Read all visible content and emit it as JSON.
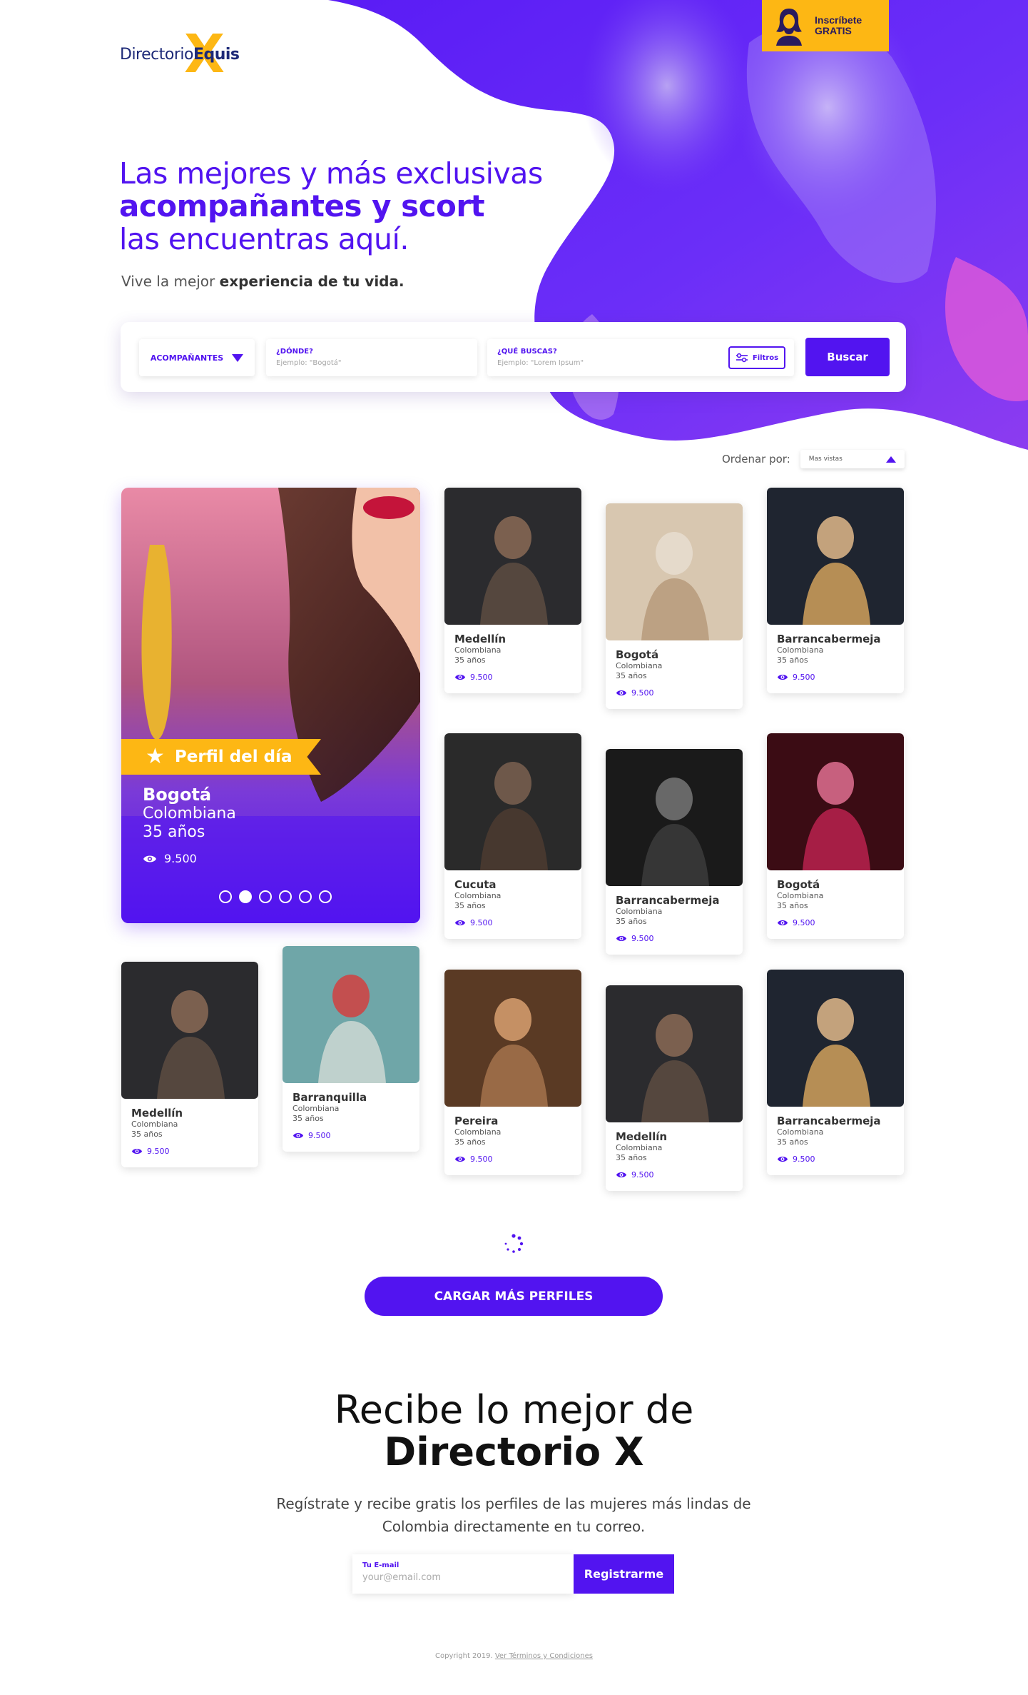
{
  "brand": {
    "name_regular": "Directorio",
    "name_bold": "Equis",
    "mark": "X"
  },
  "header": {
    "signup_line1": "Inscríbete",
    "signup_line2": "GRATIS"
  },
  "hero": {
    "line1": "Las mejores y más exclusivas",
    "line2": "acompañantes y scort",
    "line3": "las encuentras aquí.",
    "tagline_regular": "Vive la mejor ",
    "tagline_bold": "experiencia de tu vida."
  },
  "search": {
    "category": "ACOMPAÑANTES",
    "where_label": "¿DÓNDE?",
    "where_placeholder": "Ejemplo: \"Bogotá\"",
    "what_label": "¿QUÉ BUSCAS?",
    "what_placeholder": "Ejemplo: \"Lorem Ipsum\"",
    "filters_label": "Filtros",
    "submit_label": "Buscar"
  },
  "sort": {
    "label": "Ordenar por:",
    "value": "Mas vistas"
  },
  "featured": {
    "badge": "Perfil del día",
    "city": "Bogotá",
    "nationality": "Colombiana",
    "age": "35 años",
    "views": "9.500",
    "slide_count": 6,
    "active_slide": 2
  },
  "profiles": [
    {
      "city": "Medellín",
      "nationality": "Colombiana",
      "age": "35 años",
      "views": "9.500"
    },
    {
      "city": "Bogotá",
      "nationality": "Colombiana",
      "age": "35 años",
      "views": "9.500"
    },
    {
      "city": "Barrancabermeja",
      "nationality": "Colombiana",
      "age": "35 años",
      "views": "9.500"
    },
    {
      "city": "Cucuta",
      "nationality": "Colombiana",
      "age": "35 años",
      "views": "9.500"
    },
    {
      "city": "Barrancabermeja",
      "nationality": "Colombiana",
      "age": "35 años",
      "views": "9.500"
    },
    {
      "city": "Bogotá",
      "nationality": "Colombiana",
      "age": "35 años",
      "views": "9.500"
    },
    {
      "city": "Medellín",
      "nationality": "Colombiana",
      "age": "35 años",
      "views": "9.500"
    },
    {
      "city": "Barranquilla",
      "nationality": "Colombiana",
      "age": "35 años",
      "views": "9.500"
    },
    {
      "city": "Pereira",
      "nationality": "Colombiana",
      "age": "35 años",
      "views": "9.500"
    },
    {
      "city": "Medellín",
      "nationality": "Colombiana",
      "age": "35 años",
      "views": "9.500"
    },
    {
      "city": "Barrancabermeja",
      "nationality": "Colombiana",
      "age": "35 años",
      "views": "9.500"
    }
  ],
  "load_more_label": "CARGAR MÁS PERFILES",
  "newsletter": {
    "title_line1": "Recibe lo mejor de",
    "title_line2": "Directorio X",
    "description": "Regístrate y recibe gratis los perfiles de las mujeres más lindas de Colombia directamente en tu correo.",
    "email_label": "Tu E-mail",
    "email_placeholder": "your@email.com",
    "submit_label": "Registrarme"
  },
  "footer": {
    "copyright": "Copyright 2019. ",
    "terms_link": "Ver Términos y Condiciones"
  },
  "colors": {
    "accent": "#5214f0",
    "brand_yellow": "#fdb714",
    "navy": "#1e2a78"
  },
  "icons": {
    "views": "eye-icon",
    "featured": "star-icon",
    "filters": "sliders-icon",
    "signup": "woman-silhouette-icon",
    "sort": "caret-up-icon",
    "category": "caret-down-icon"
  }
}
